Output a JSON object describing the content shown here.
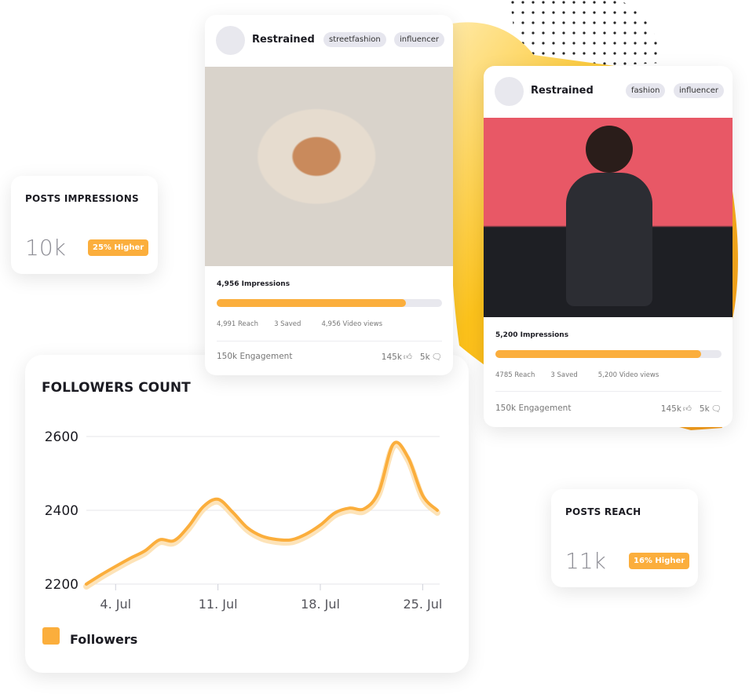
{
  "colors": {
    "accent": "#fbae3c",
    "tag_bg": "#e6e6ee"
  },
  "stats": [
    {
      "title": "POSTS IMPRESSIONS",
      "value": "10k",
      "badge": "25% Higher"
    },
    {
      "title": "POSTS REACH",
      "value": "11k",
      "badge": "16% Higher"
    }
  ],
  "posts": [
    {
      "name": "Restrained",
      "tags": [
        "streetfashion",
        "influencer"
      ],
      "impressions": "4,956 Impressions",
      "progress": 0.84,
      "reach": "4,991 Reach",
      "saved": "3 Saved",
      "video_views": "4,956 Video views",
      "engagement": "150k Engagement",
      "likes": "145k",
      "comments": "5k"
    },
    {
      "name": "Restrained",
      "tags": [
        "fashion",
        "influencer"
      ],
      "impressions": "5,200 Impressions",
      "progress": 0.91,
      "reach": "4785 Reach",
      "saved": "3 Saved",
      "video_views": "5,200 Video views",
      "engagement": "150k Engagement",
      "likes": "145k",
      "comments": "5k"
    }
  ],
  "chart_data": {
    "type": "line",
    "title": "FOLLOWERS COUNT",
    "xlabel": "",
    "ylabel": "",
    "x": [
      "2 Jul",
      "3 Jul",
      "4 Jul",
      "5 Jul",
      "6 Jul",
      "7 Jul",
      "8 Jul",
      "9 Jul",
      "10 Jul",
      "11 Jul",
      "12 Jul",
      "13 Jul",
      "14 Jul",
      "15 Jul",
      "16 Jul",
      "17 Jul",
      "18 Jul",
      "19 Jul",
      "20 Jul",
      "21 Jul",
      "22 Jul",
      "23 Jul",
      "24 Jul",
      "25 Jul",
      "26 Jul"
    ],
    "series": [
      {
        "name": "Followers",
        "color": "#fbae3c",
        "values": [
          2200,
          2225,
          2248,
          2270,
          2290,
          2320,
          2318,
          2357,
          2410,
          2430,
          2395,
          2353,
          2330,
          2321,
          2320,
          2335,
          2360,
          2393,
          2406,
          2404,
          2450,
          2580,
          2543,
          2440,
          2400
        ]
      }
    ],
    "x_ticks": [
      "4. Jul",
      "11. Jul",
      "18. Jul",
      "25. Jul"
    ],
    "y_ticks": [
      "2200",
      "2400",
      "2600"
    ],
    "ylim": [
      2200,
      2600
    ],
    "grid": true,
    "legend": "bottom-left"
  }
}
